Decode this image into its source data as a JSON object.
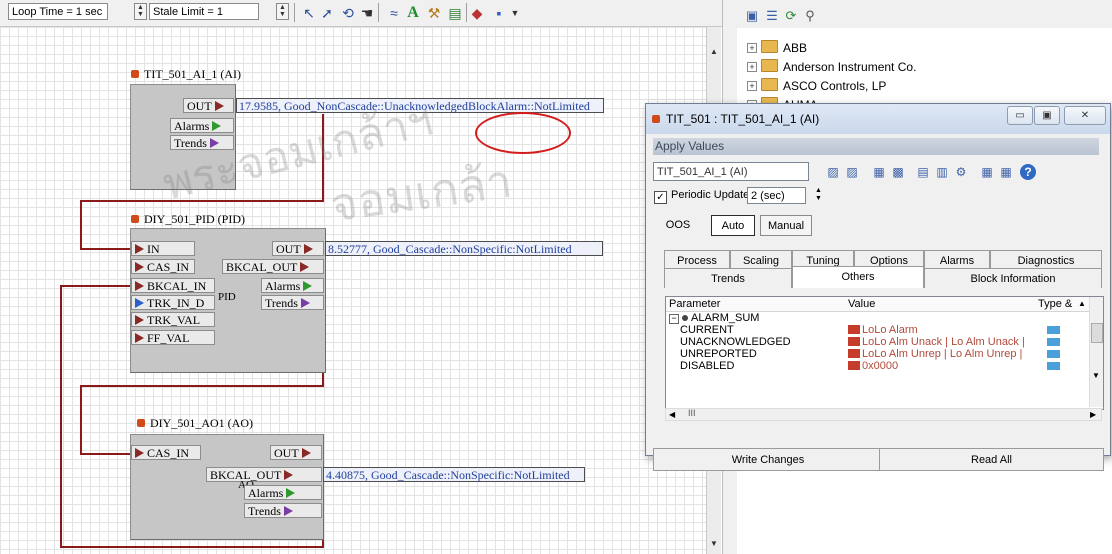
{
  "toolbar": {
    "loop_time": "Loop Time = 1 sec",
    "stale_limit": "Stale Limit = 1",
    "icons": [
      "select-arrow-icon",
      "connect-arrow-icon",
      "refresh-icon",
      "hand-icon",
      "signal-icon",
      "text-A-icon",
      "tool-icon",
      "chart-icon",
      "diamond-icon",
      "color-picker-icon"
    ]
  },
  "canvas": {
    "ai_block": {
      "title": "TIT_501_AI_1 (AI)",
      "out_label": "OUT",
      "alarms_label": "Alarms",
      "trends_label": "Trends",
      "value": "17.9585, Good_NonCascade::UnacknowledgedBlockAlarm::NotLimited"
    },
    "pid_block": {
      "title": "DIY_501_PID (PID)",
      "in_label": "IN",
      "cas_in_label": "CAS_IN",
      "bkcal_in_label": "BKCAL_IN",
      "trk_in_d_label": "TRK_IN_D",
      "trk_val_label": "TRK_VAL",
      "ff_val_label": "FF_VAL",
      "out_label": "OUT",
      "bkcal_out_label": "BKCAL_OUT",
      "alarms_label": "Alarms",
      "trends_label": "Trends",
      "type_label": "PID",
      "value": "8.52777, Good_Cascade::NonSpecific:NotLimited"
    },
    "ao_block": {
      "title": "DIY_501_AO1 (AO)",
      "cas_in_label": "CAS_IN",
      "out_label": "OUT",
      "bkcal_out_label": "BKCAL_OUT",
      "alarms_label": "Alarms",
      "trends_label": "Trends",
      "type_label": "AO",
      "value": "4.40875, Good_Cascade::NonSpecific:NotLimited"
    }
  },
  "tree": {
    "items": [
      "ABB",
      "Anderson Instrument Co.",
      "ASCO Controls, LP",
      "AUMA"
    ]
  },
  "dialog": {
    "title": "TIT_501 : TIT_501_AI_1 (AI)",
    "apply_values": "Apply Values",
    "block_select": "TIT_501_AI_1 (AI)",
    "periodic_updates_label": "Periodic Updates",
    "periodic_updates_checked": true,
    "period": "2 (sec)",
    "modes": [
      "OOS",
      "Auto",
      "Manual"
    ],
    "active_mode": "Auto",
    "tabs_row1": [
      "Process",
      "Scaling",
      "Tuning",
      "Options",
      "Alarms",
      "Diagnostics"
    ],
    "tabs_row2": [
      "Trends",
      "Others",
      "Block Information"
    ],
    "active_tab": "Others",
    "columns": [
      "Parameter",
      "Value",
      "Type &"
    ],
    "group": "ALARM_SUM",
    "rows": [
      {
        "param": "CURRENT",
        "value": "LoLo Alarm"
      },
      {
        "param": "UNACKNOWLEDGED",
        "value": "LoLo Alm Unack | Lo Alm Unack |"
      },
      {
        "param": "UNREPORTED",
        "value": "LoLo Alm Unrep | Lo Alm Unrep |"
      },
      {
        "param": "DISABLED",
        "value": "0x0000"
      }
    ],
    "write_changes": "Write Changes",
    "read_all": "Read All",
    "scroll_mark": "III"
  },
  "watermark": {
    "line1": "พระจอมเกล้าฯ",
    "line2": "จอมเกล้า"
  },
  "colors": {
    "wire": "#8b1a1a",
    "value_text": "#1f3f9c",
    "annotation": "#d41d1d"
  }
}
